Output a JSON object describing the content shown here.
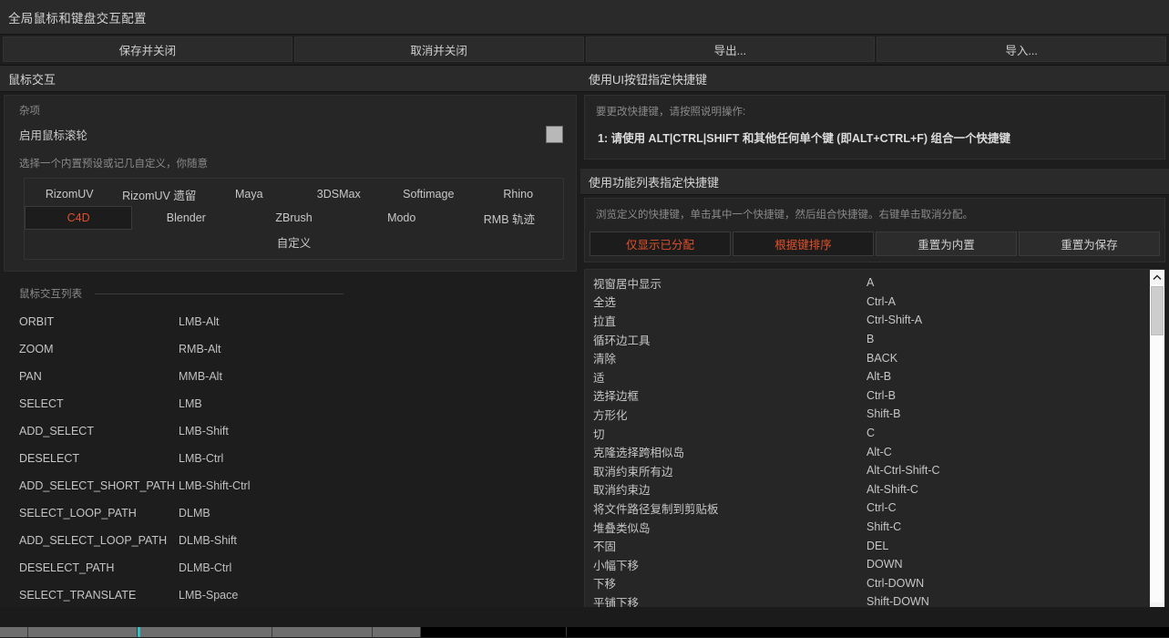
{
  "window": {
    "title": "全局鼠标和键盘交互配置"
  },
  "toolbar": {
    "buttons": [
      {
        "label": "保存并关闭",
        "name": "save-and-close-button"
      },
      {
        "label": "取消并关闭",
        "name": "cancel-and-close-button"
      },
      {
        "label": "导出...",
        "name": "export-button"
      },
      {
        "label": "导入...",
        "name": "import-button"
      }
    ]
  },
  "left": {
    "panel_title": "鼠标交互",
    "misc": {
      "group_title": "杂项",
      "enable_wheel_label": "启用鼠标滚轮",
      "enable_wheel_checked": true,
      "preset_hint": "选择一个内置预设或记几自定义，你随意",
      "presets": [
        {
          "label": "RizomUV",
          "active": false
        },
        {
          "label": "RizomUV 遗留",
          "active": false
        },
        {
          "label": "Maya",
          "active": false
        },
        {
          "label": "3DSMax",
          "active": false
        },
        {
          "label": "Softimage",
          "active": false
        },
        {
          "label": "Rhino",
          "active": false
        },
        {
          "label": "C4D",
          "active": true
        },
        {
          "label": "Blender",
          "active": false
        },
        {
          "label": "ZBrush",
          "active": false
        },
        {
          "label": "Modo",
          "active": false
        },
        {
          "label": "RMB 轨迹",
          "active": false
        },
        {
          "label": "",
          "active": false
        },
        {
          "label": "自定义",
          "active": false
        },
        {
          "label": "",
          "active": false
        }
      ]
    },
    "interaction_list": {
      "title": "鼠标交互列表",
      "rows": [
        {
          "name": "ORBIT",
          "bind": "LMB-Alt"
        },
        {
          "name": "ZOOM",
          "bind": "RMB-Alt"
        },
        {
          "name": "PAN",
          "bind": "MMB-Alt"
        },
        {
          "name": "SELECT",
          "bind": "LMB"
        },
        {
          "name": "ADD_SELECT",
          "bind": "LMB-Shift"
        },
        {
          "name": "DESELECT",
          "bind": "LMB-Ctrl"
        },
        {
          "name": "ADD_SELECT_SHORT_PATH",
          "bind": "LMB-Shift-Ctrl"
        },
        {
          "name": "SELECT_LOOP_PATH",
          "bind": "DLMB"
        },
        {
          "name": "ADD_SELECT_LOOP_PATH",
          "bind": "DLMB-Shift"
        },
        {
          "name": "DESELECT_PATH",
          "bind": "DLMB-Ctrl"
        },
        {
          "name": "SELECT_TRANSLATE",
          "bind": "LMB-Space"
        }
      ]
    }
  },
  "right": {
    "ui_button_panel": {
      "title": "使用UI按钮指定快捷键",
      "instruction_header": "要更改快捷键，请按照说明操作:",
      "instruction_step": "1: 请使用 ALT|CTRL|SHIFT 和其他任何单个键 (即ALT+CTRL+F) 组合一个快捷键"
    },
    "function_list_panel": {
      "title": "使用功能列表指定快捷键",
      "hint": "浏览定义的快捷键，单击其中一个快捷键，然后组合快捷键。右键单击取消分配。",
      "filters": [
        {
          "label": "仅显示已分配",
          "state": "on"
        },
        {
          "label": "根据键排序",
          "state": "on"
        },
        {
          "label": "重置为内置",
          "state": "off"
        },
        {
          "label": "重置为保存",
          "state": "off"
        }
      ],
      "shortcuts": [
        {
          "command": "视窗居中显示",
          "key": "A"
        },
        {
          "command": "全选",
          "key": "Ctrl-A"
        },
        {
          "command": "拉直",
          "key": "Ctrl-Shift-A"
        },
        {
          "command": "循环边工具",
          "key": "B"
        },
        {
          "command": "清除",
          "key": "BACK"
        },
        {
          "command": "适",
          "key": "Alt-B"
        },
        {
          "command": "选择边框",
          "key": "Ctrl-B"
        },
        {
          "command": "方形化",
          "key": "Shift-B"
        },
        {
          "command": "切",
          "key": "C"
        },
        {
          "command": "克隆选择跨相似岛",
          "key": "Alt-C"
        },
        {
          "command": "取消约束所有边",
          "key": "Alt-Ctrl-Shift-C"
        },
        {
          "command": "取消约束边",
          "key": "Alt-Shift-C"
        },
        {
          "command": "将文件路径复制到剪贴板",
          "key": "Ctrl-C"
        },
        {
          "command": "堆叠类似岛",
          "key": "Shift-C"
        },
        {
          "command": "不固",
          "key": "DEL"
        },
        {
          "command": "小幅下移",
          "key": "DOWN"
        },
        {
          "command": "下移",
          "key": "Ctrl-DOWN"
        },
        {
          "command": "平铺下移",
          "key": "Shift-DOWN"
        }
      ]
    }
  },
  "colors": {
    "accent": "#e0502a",
    "panel_bg": "#262626",
    "window_bg": "#1d1d1d",
    "header_bg": "#2a2a2a",
    "text": "#c8c8c8",
    "muted_text": "#8a8a8a"
  }
}
